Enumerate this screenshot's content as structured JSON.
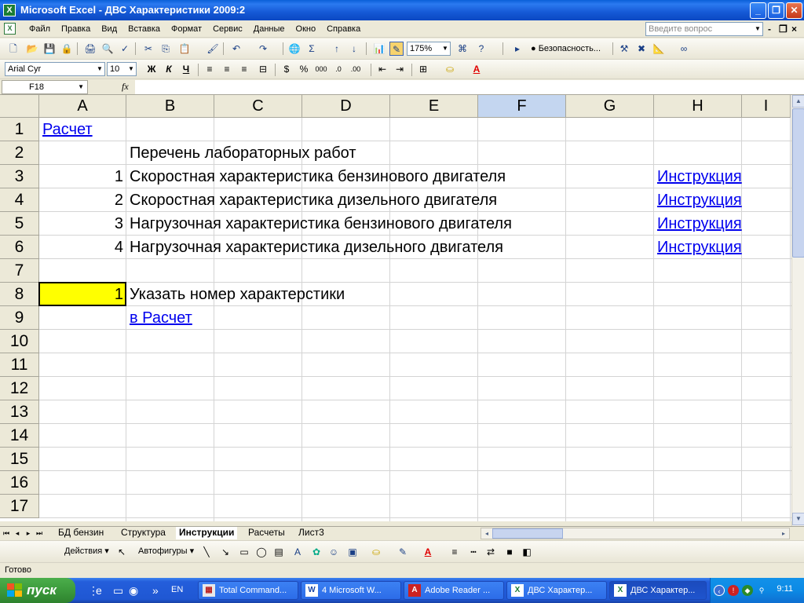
{
  "window": {
    "title": "Microsoft Excel - ДВС Характеристики 2009:2",
    "app_icon": "X"
  },
  "menu": {
    "items": [
      "Файл",
      "Правка",
      "Вид",
      "Вставка",
      "Формат",
      "Сервис",
      "Данные",
      "Окно",
      "Справка"
    ],
    "ask_placeholder": "Введите вопрос"
  },
  "toolbar": {
    "zoom": "175%",
    "security_label": "Безопасность..."
  },
  "format_toolbar": {
    "font_name": "Arial Cyr",
    "font_size": "10"
  },
  "formula_bar": {
    "name_box": "F18",
    "fx_label": "fx",
    "formula": ""
  },
  "sheet": {
    "columns": [
      "A",
      "B",
      "C",
      "D",
      "E",
      "F",
      "G",
      "H",
      "I"
    ],
    "selected_column": "F",
    "rows": [
      "1",
      "2",
      "3",
      "4",
      "5",
      "6",
      "7",
      "8",
      "9",
      "10",
      "11",
      "12",
      "13",
      "14",
      "15",
      "16",
      "17"
    ],
    "cells": {
      "A1": "Расчет",
      "B2": "Перечень лабораторных работ",
      "A3": "1",
      "B3": "Скоростная характеристика бензинового двигателя",
      "H3": "Инструкция",
      "A4": "2",
      "B4": "Скоростная характеристика дизельного двигателя",
      "H4": "Инструкция",
      "A5": "3",
      "B5": "Нагрузочная характеристика бензинового двигателя",
      "H5": "Инструкция",
      "A6": "4",
      "B6": "Нагрузочная характеристика дизельного  двигателя",
      "H6": "Инструкция",
      "A8": "1",
      "B8": "Указать номер характерстики",
      "B9": "в Расчет"
    },
    "highlight_color": "#ffff00",
    "link_color": "#0000ee"
  },
  "tabs": {
    "items": [
      "БД бензин",
      "Структура",
      "Инструкции",
      "Расчеты",
      "Лист3"
    ],
    "active": "Инструкции"
  },
  "drawing": {
    "actions_label": "Действия",
    "autoshapes_label": "Автофигуры"
  },
  "status": {
    "text": "Готово"
  },
  "taskbar": {
    "start_label": "пуск",
    "lang": "EN",
    "tasks": [
      {
        "label": "Total Command...",
        "icon": "TC"
      },
      {
        "label": "4 Microsoft W...",
        "icon": "W"
      },
      {
        "label": "Adobe Reader ...",
        "icon": "A"
      },
      {
        "label": "ДВС Характер...",
        "icon": "X"
      },
      {
        "label": "ДВС Характер...",
        "icon": "X"
      }
    ],
    "clock": "9:11"
  }
}
